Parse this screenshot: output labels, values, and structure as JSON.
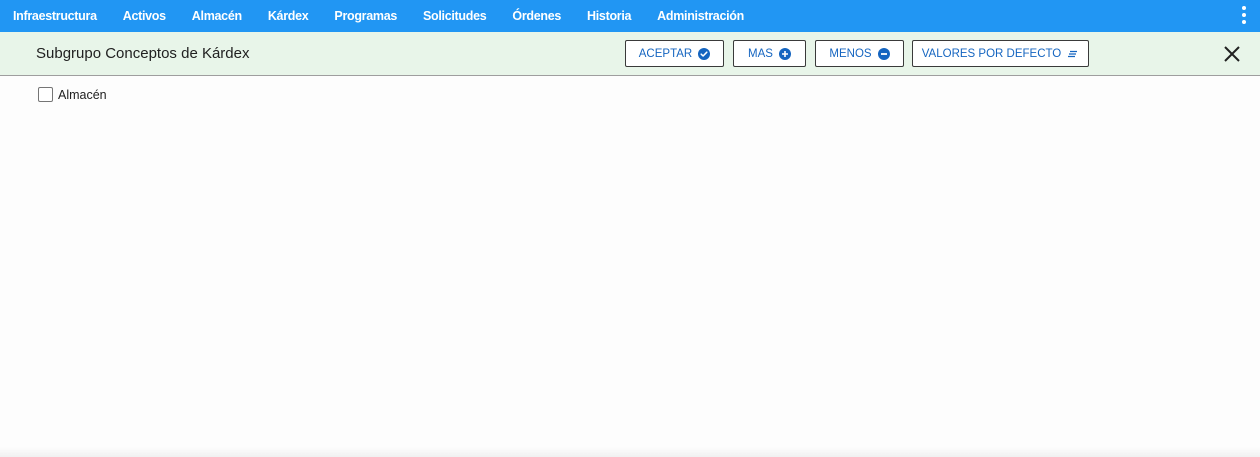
{
  "nav": {
    "items": [
      {
        "label": "Infraestructura"
      },
      {
        "label": "Activos"
      },
      {
        "label": "Almacén"
      },
      {
        "label": "Kárdex"
      },
      {
        "label": "Programas"
      },
      {
        "label": "Solicitudes"
      },
      {
        "label": "Órdenes"
      },
      {
        "label": "Historia"
      },
      {
        "label": "Administración"
      }
    ],
    "menu_icon": "more-vertical-icon"
  },
  "titlebar": {
    "title": "Subgrupo Conceptos de Kárdex",
    "buttons": {
      "aceptar": {
        "label": "ACEPTAR",
        "icon": "check-circle-icon"
      },
      "mas": {
        "label": "MAS",
        "icon": "plus-circle-icon"
      },
      "menos": {
        "label": "MENOS",
        "icon": "minus-circle-icon"
      },
      "defecto": {
        "label": "VALORES POR DEFECTO",
        "icon": "notes-icon"
      }
    },
    "close_icon": "close-icon"
  },
  "content": {
    "checkbox": {
      "label": "Almacén",
      "checked": false
    }
  },
  "colors": {
    "nav_bg": "#2196f3",
    "titlebar_bg": "#e8f5e9",
    "button_text": "#1565c0"
  }
}
